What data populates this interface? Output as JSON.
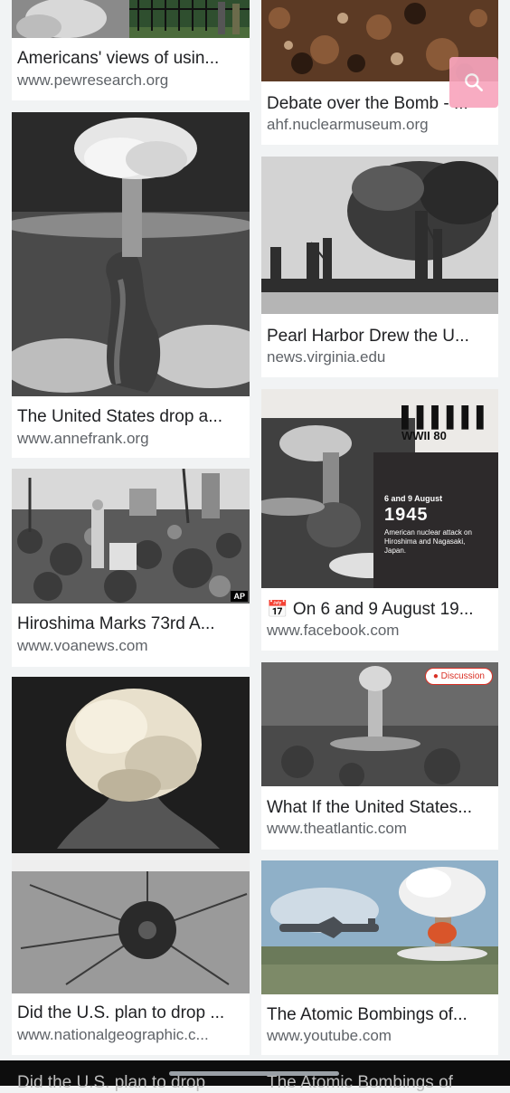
{
  "results": {
    "left": [
      {
        "title": "Americans' views of usin...",
        "source": "www.pewresearch.org"
      },
      {
        "title": "The United States drop a...",
        "source": "www.annefrank.org"
      },
      {
        "title": "Hiroshima Marks 73rd A...",
        "source": "www.voanews.com",
        "badge": "AP"
      },
      {
        "title": "Did the U.S. plan to drop ...",
        "source": "www.nationalgeographic.c..."
      }
    ],
    "right": [
      {
        "title": "Debate over the Bomb - ...",
        "source": "ahf.nuclearmuseum.org"
      },
      {
        "title": "Pearl Harbor Drew the U...",
        "source": "news.virginia.edu"
      },
      {
        "title": "📅 On 6 and 9 August 19...",
        "source": "www.facebook.com",
        "overlay": {
          "logo": "▌▌▌▌▌▌",
          "brand": "WWII 80",
          "line1": "6 and 9 August",
          "year": "1945",
          "desc": "American nuclear attack on Hiroshima and Nagasaki, Japan."
        }
      },
      {
        "title": "What If the United States...",
        "source": "www.theatlantic.com",
        "badge": "Discussion"
      },
      {
        "title": "The Atomic Bombings of...",
        "source": "www.youtube.com"
      }
    ]
  },
  "peek": {
    "left": "Did the U.S. plan to drop",
    "right": "The Atomic Bombings of"
  },
  "icons": {
    "search_fab": "search-icon",
    "discussion": "chat-icon"
  },
  "colors": {
    "background": "#f1f3f4",
    "fab": "#f8a5bd",
    "discussion": "#d93025"
  }
}
